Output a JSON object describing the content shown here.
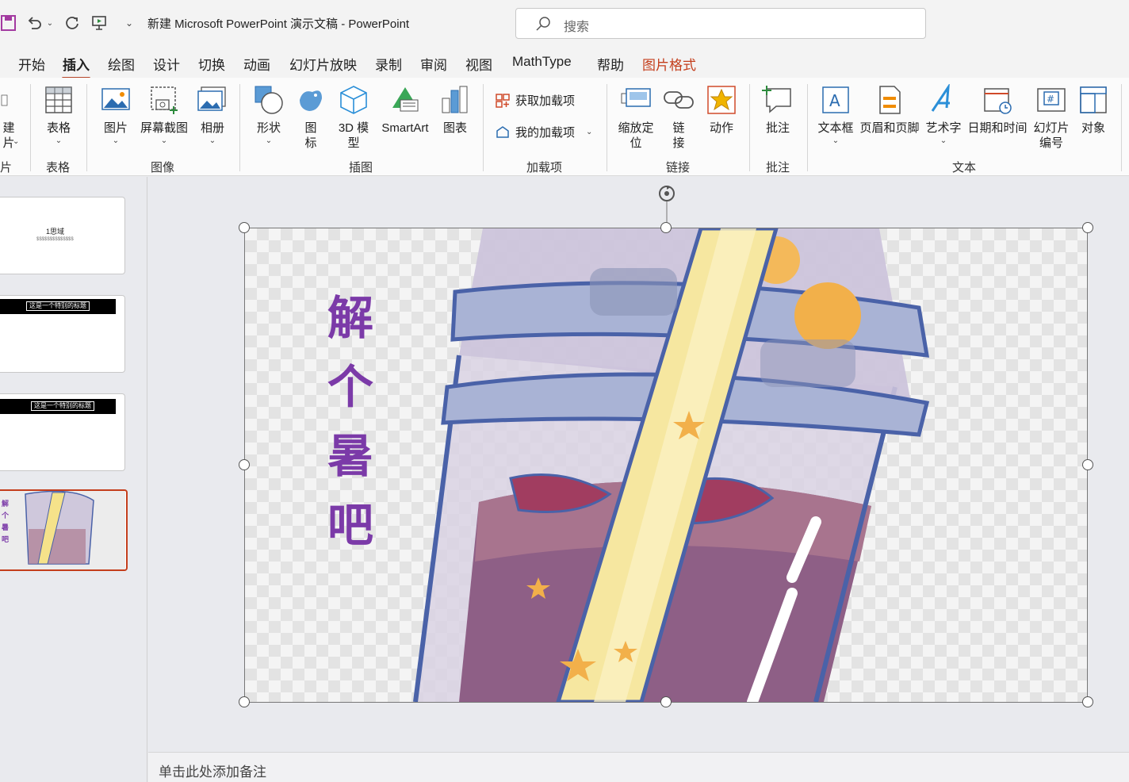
{
  "titlebar": {
    "document_title": "新建 Microsoft PowerPoint 演示文稿  -  PowerPoint",
    "search_placeholder": "搜索"
  },
  "tabs": [
    {
      "label": "开始"
    },
    {
      "label": "插入"
    },
    {
      "label": "绘图"
    },
    {
      "label": "设计"
    },
    {
      "label": "切换"
    },
    {
      "label": "动画"
    },
    {
      "label": "幻灯片放映"
    },
    {
      "label": "录制"
    },
    {
      "label": "审阅"
    },
    {
      "label": "视图"
    },
    {
      "label": "MathType"
    },
    {
      "label": "帮助"
    },
    {
      "label": "图片格式"
    }
  ],
  "ribbon": {
    "new_slide": {
      "line1": "建",
      "line2": "片"
    },
    "new_slide_group": "片",
    "table": {
      "label": "表格",
      "group": "表格"
    },
    "images": {
      "picture": "图片",
      "screenshot": "屏幕截图",
      "album": "相册",
      "group": "图像"
    },
    "illustrations": {
      "shapes": "形状",
      "icons1": "图",
      "icons2": "标",
      "model1": "3D 模",
      "model2": "型",
      "smartart": "SmartArt",
      "chart": "图表",
      "group": "插图"
    },
    "addins": {
      "get": "获取加载项",
      "mine": "我的加载项",
      "group": "加载项"
    },
    "links": {
      "zoom1": "缩放定",
      "zoom2": "位",
      "link1": "链",
      "link2": "接",
      "action": "动作",
      "group": "链接"
    },
    "comments": {
      "comment": "批注",
      "group": "批注"
    },
    "text": {
      "textbox": "文本框",
      "header_footer": "页眉和页脚",
      "wordart": "艺术字",
      "datetime": "日期和时间",
      "slide_num1": "幻灯片",
      "slide_num2": "编号",
      "object": "对象",
      "group": "文本"
    }
  },
  "slides": [
    {
      "title": "1思域",
      "subtitle": "$$$$$$$$$$$$$$"
    },
    {
      "title": "这是一个特别的标题"
    },
    {
      "title": "这是一个特别的标题"
    },
    {
      "title": "解个暑吧",
      "chars": [
        "解",
        "个",
        "暑",
        "吧"
      ]
    }
  ],
  "picture": {
    "text": "解个暑吧",
    "chars": [
      "解",
      "个",
      "暑",
      "吧"
    ]
  },
  "notes": {
    "placeholder": "单击此处添加备注"
  },
  "colors": {
    "accent": "#c43e1c",
    "picture_text": "#7b3aa8"
  }
}
